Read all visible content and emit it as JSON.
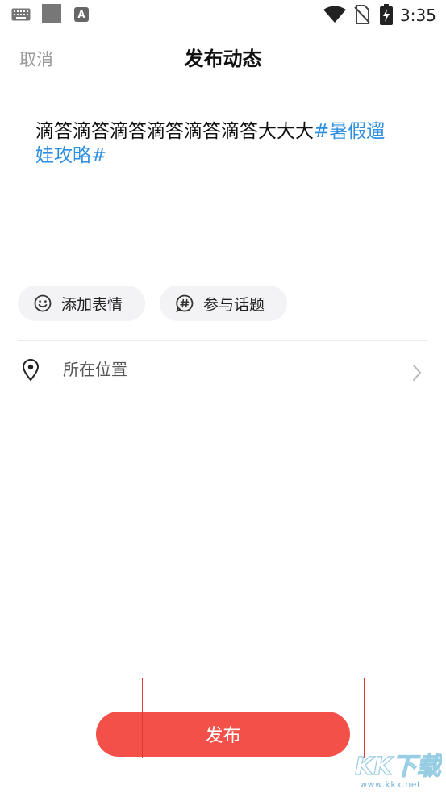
{
  "status_bar": {
    "time": "3:35",
    "notification_badge": "A"
  },
  "header": {
    "cancel_label": "取消",
    "title": "发布动态"
  },
  "post": {
    "text": "滴答滴答滴答滴答滴答滴答大大大",
    "hashtag": "#暑假遛娃攻略#"
  },
  "actions": {
    "emoji_label": "添加表情",
    "topic_label": "参与话题"
  },
  "location": {
    "label": "所在位置"
  },
  "publish": {
    "label": "发布"
  },
  "watermark": {
    "logo_text": "KK下载",
    "url": "www.kkx.net"
  },
  "colors": {
    "accent": "#f4504a",
    "hashtag": "#2e8fe0",
    "highlight_box": "#e53935"
  },
  "icons": [
    "keyboard-icon",
    "notification-square-icon",
    "a-notification-icon",
    "wifi-icon",
    "no-sim-icon",
    "battery-charging-icon",
    "emoji-icon",
    "hashtag-icon",
    "location-pin-icon",
    "chevron-right-icon"
  ]
}
